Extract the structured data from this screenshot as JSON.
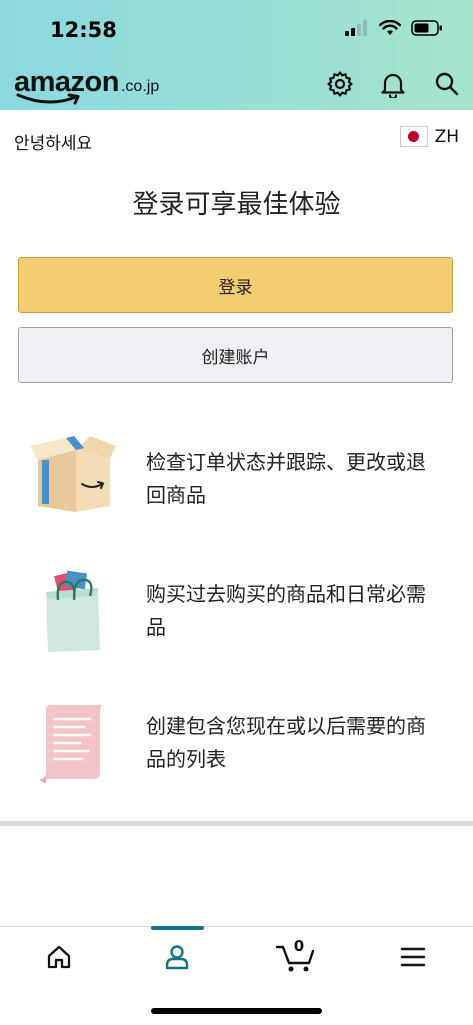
{
  "status_bar": {
    "time": "12:58"
  },
  "header": {
    "logo_text": "amazon",
    "logo_domain": ".co.jp",
    "icons": [
      "gear-icon",
      "bell-icon",
      "search-icon"
    ]
  },
  "greeting": "안녕하세요",
  "language": {
    "code": "ZH",
    "flag": "japan-flag"
  },
  "headline": "登录可享最佳体验",
  "buttons": {
    "sign_in": "登录",
    "create_account": "创建账户"
  },
  "features": [
    {
      "icon": "package-box-icon",
      "line1": "检查订单状态并跟踪、更改或退",
      "line2": "回商品"
    },
    {
      "icon": "shopping-bag-icon",
      "line1": "购买过去购买的商品和日常必需",
      "line2": "品"
    },
    {
      "icon": "list-scroll-icon",
      "line1": "创建包含您现在或以后需要的商",
      "line2": "品的列表"
    }
  ],
  "tabbar": {
    "tabs": [
      "home-icon",
      "account-icon",
      "cart-icon",
      "menu-icon"
    ],
    "cart_count": "0",
    "active_tab": "account",
    "accent_color": "#137583"
  },
  "colors": {
    "signin_button": "#f2cd72",
    "create_button": "#eff0f3"
  }
}
